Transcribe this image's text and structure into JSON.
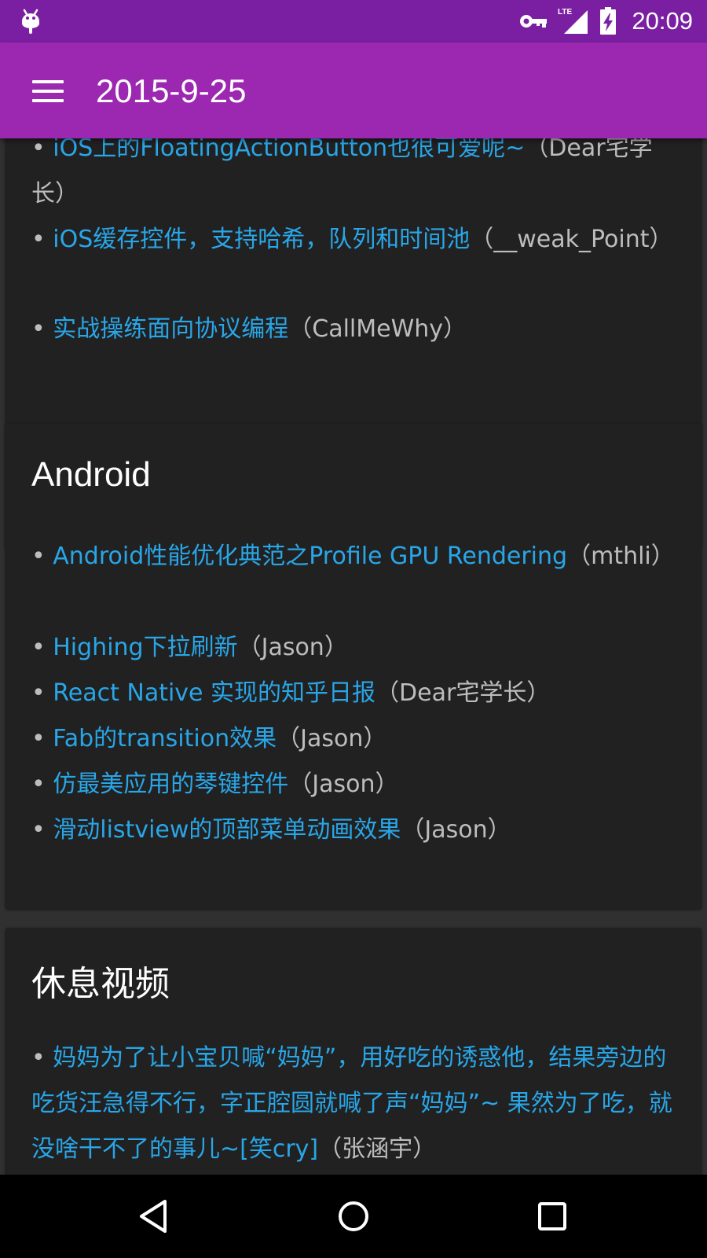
{
  "status_bar": {
    "time": "20:09",
    "network": "LTE",
    "icons": [
      "android-icon",
      "key-icon",
      "signal-icon",
      "battery-charging-icon"
    ]
  },
  "app_bar": {
    "title": "2015-9-25",
    "menu_icon": "menu-icon"
  },
  "colors": {
    "status_bar": "#7B1FA2",
    "app_bar": "#9C27B0",
    "link": "#29a6e8",
    "card": "#212121",
    "background": "#303030"
  },
  "sections": [
    {
      "title": "",
      "items": [
        {
          "bullet": "•",
          "link": "iOS上的FloatingActionButton也很可爱呢~",
          "author": "（Dear宅学长）"
        },
        {
          "bullet": "•",
          "link": "iOS缓存控件，支持哈希，队列和时间池",
          "author": "（__weak_Point）"
        },
        {
          "bullet": "•",
          "link": "实战操练面向协议编程",
          "author": "（CallMeWhy）"
        }
      ]
    },
    {
      "title": "Android",
      "items": [
        {
          "bullet": "•",
          "link": "Android性能优化典范之Profile GPU Rendering",
          "author": "（mthli）"
        },
        {
          "bullet": "•",
          "link": "Highing下拉刷新",
          "author": "（Jason）"
        },
        {
          "bullet": "•",
          "link": "React Native 实现的知乎日报",
          "author": "（Dear宅学长）"
        },
        {
          "bullet": "•",
          "link": "Fab的transition效果",
          "author": "（Jason）"
        },
        {
          "bullet": "•",
          "link": "仿最美应用的琴键控件",
          "author": "（Jason）"
        },
        {
          "bullet": "•",
          "link": "滑动listview的顶部菜单动画效果",
          "author": "（Jason）"
        }
      ]
    },
    {
      "title": "休息视频",
      "items": [
        {
          "bullet": "•",
          "link": "妈妈为了让小宝贝喊“妈妈”，用好吃的诱惑他，结果旁边的吃货汪急得不行，字正腔圆就喊了声“妈妈”~ 果然为了吃，就没啥干不了的事儿~[笑cry]",
          "author": "（张涵宇）"
        }
      ]
    }
  ],
  "nav_bar": {
    "icons": [
      "back-icon",
      "home-icon",
      "recents-icon"
    ]
  }
}
